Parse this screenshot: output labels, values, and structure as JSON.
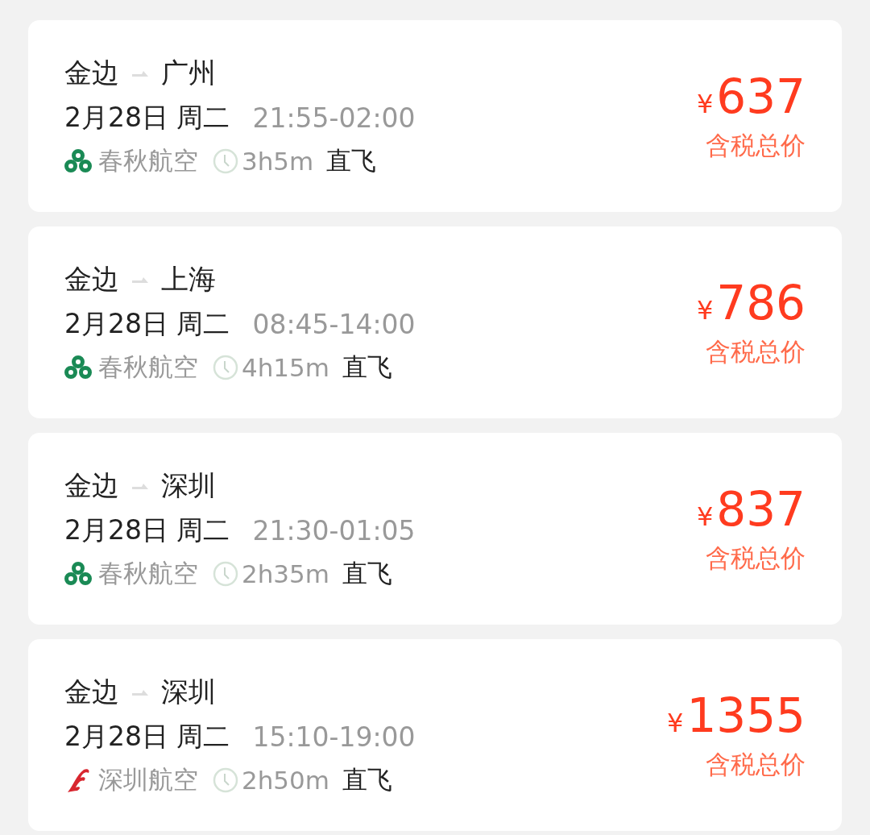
{
  "flights": [
    {
      "from": "金边",
      "to": "广州",
      "date": "2月28日 周二",
      "time": "21:55-02:00",
      "airline": {
        "name": "春秋航空",
        "kind": "spring"
      },
      "duration": "3h5m",
      "type": "直飞",
      "currency": "¥",
      "price": "637",
      "price_note": "含税总价"
    },
    {
      "from": "金边",
      "to": "上海",
      "date": "2月28日 周二",
      "time": "08:45-14:00",
      "airline": {
        "name": "春秋航空",
        "kind": "spring"
      },
      "duration": "4h15m",
      "type": "直飞",
      "currency": "¥",
      "price": "786",
      "price_note": "含税总价"
    },
    {
      "from": "金边",
      "to": "深圳",
      "date": "2月28日 周二",
      "time": "21:30-01:05",
      "airline": {
        "name": "春秋航空",
        "kind": "spring"
      },
      "duration": "2h35m",
      "type": "直飞",
      "currency": "¥",
      "price": "837",
      "price_note": "含税总价"
    },
    {
      "from": "金边",
      "to": "深圳",
      "date": "2月28日 周二",
      "time": "15:10-19:00",
      "airline": {
        "name": "深圳航空",
        "kind": "shenzhen"
      },
      "duration": "2h50m",
      "type": "直飞",
      "currency": "¥",
      "price": "1355",
      "price_note": "含税总价"
    }
  ]
}
